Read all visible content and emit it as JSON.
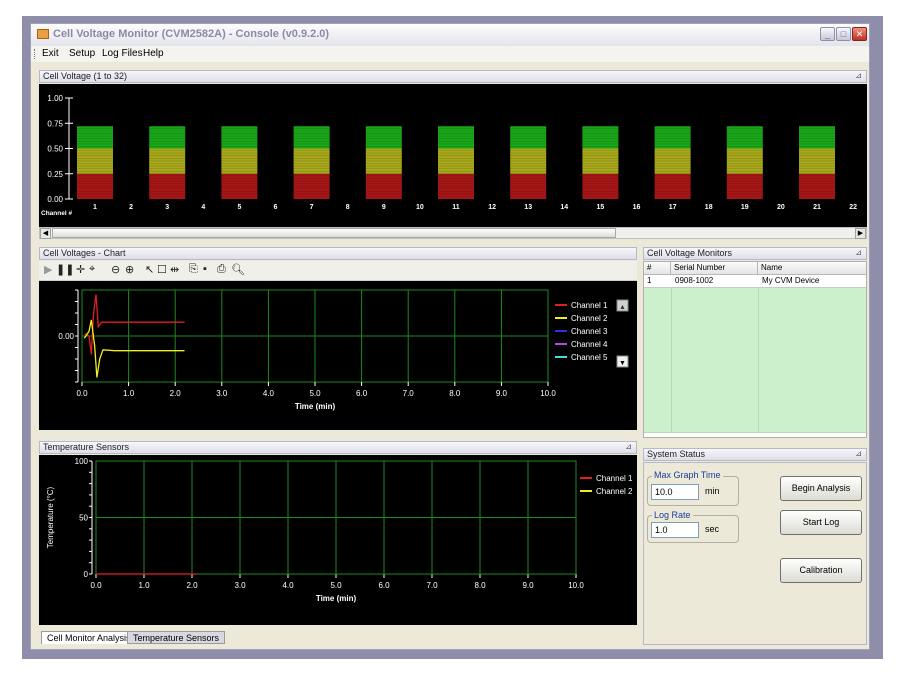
{
  "window": {
    "title": "Cell Voltage Monitor (CVM2582A) - Console (v0.9.2.0)",
    "minimize": "_",
    "maximize": "□",
    "close": "✕"
  },
  "menu": [
    "Exit",
    "Setup",
    "Log Files",
    "Help"
  ],
  "voltage_panel": {
    "title": "Cell Voltage (1 to 32)",
    "channel_label": "Channel #",
    "colors": {
      "high": "#19a619",
      "mid": "#a8a81c",
      "low": "#a61616"
    }
  },
  "chart_panel": {
    "title": "Cell Voltages - Chart",
    "toolbar_icons": [
      "play-icon",
      "pause-icon",
      "pan-icon",
      "zoom-box-icon",
      "zoom-out-icon",
      "zoom-in-icon",
      "pointer-icon",
      "select-box-icon",
      "fit-width-icon",
      "copy-icon",
      "save-icon",
      "print-icon",
      "print-preview-icon"
    ]
  },
  "temp_panel": {
    "title": "Temperature Sensors"
  },
  "monitors_panel": {
    "title": "Cell Voltage Monitors",
    "columns": [
      "#",
      "Serial Number",
      "Name"
    ],
    "rows": [
      [
        "1",
        "0908-1002",
        "My CVM Device"
      ]
    ]
  },
  "status_panel": {
    "title": "System Status",
    "max_graph_time": {
      "label": "Max Graph Time",
      "value": "10.0",
      "unit": "min"
    },
    "log_rate": {
      "label": "Log Rate",
      "value": "1.0",
      "unit": "sec"
    },
    "buttons": {
      "begin": "Begin Analysis",
      "start_log": "Start Log",
      "calibration": "Calibration"
    }
  },
  "tabs": [
    "Cell Monitor Analysis",
    "Temperature Sensors"
  ],
  "chart_data": [
    {
      "type": "bar",
      "title": "Cell Voltage (1 to 32)",
      "xlabel": "Channel #",
      "categories": [
        "1",
        "2",
        "3",
        "4",
        "5",
        "6",
        "7",
        "8",
        "9",
        "10",
        "11",
        "12",
        "13",
        "14",
        "15",
        "16",
        "17",
        "18",
        "19",
        "20",
        "21",
        "22"
      ],
      "values": [
        0.72,
        0,
        0.72,
        0,
        0.72,
        0,
        0.72,
        0,
        0.72,
        0,
        0.72,
        0,
        0.72,
        0,
        0.72,
        0,
        0.72,
        0,
        0.72,
        0,
        0.72,
        0
      ],
      "ylim": [
        0,
        1.0
      ],
      "yticks": [
        "0.00",
        "0.25",
        "0.50",
        "0.75",
        "1.00"
      ],
      "color_bands": [
        {
          "from": 0,
          "to": 0.25,
          "color": "#a61616"
        },
        {
          "from": 0.25,
          "to": 0.5,
          "color": "#a8a81c"
        },
        {
          "from": 0.5,
          "to": 0.75,
          "color": "#19a619"
        }
      ]
    },
    {
      "type": "line",
      "xlabel": "Time (min)",
      "xticks": [
        "0.0",
        "1.0",
        "2.0",
        "3.0",
        "4.0",
        "5.0",
        "6.0",
        "7.0",
        "8.0",
        "9.0",
        "10.0"
      ],
      "yticks": [
        "0.00"
      ],
      "xlim": [
        0,
        10
      ],
      "ylim": [
        -1,
        1
      ],
      "grid": true,
      "legend": "right",
      "series": [
        {
          "name": "Channel 1",
          "color": "#e02020",
          "points": [
            [
              0.05,
              0.05
            ],
            [
              0.15,
              0.0
            ],
            [
              0.2,
              -0.4
            ],
            [
              0.25,
              0.5
            ],
            [
              0.3,
              0.9
            ],
            [
              0.35,
              0.2
            ],
            [
              0.42,
              0.3
            ],
            [
              0.6,
              0.3
            ],
            [
              2.2,
              0.3
            ]
          ]
        },
        {
          "name": "Channel 2",
          "color": "#f0f020",
          "points": [
            [
              0.05,
              -0.05
            ],
            [
              0.15,
              0.1
            ],
            [
              0.2,
              0.35
            ],
            [
              0.27,
              -0.2
            ],
            [
              0.32,
              -0.9
            ],
            [
              0.38,
              -0.5
            ],
            [
              0.45,
              -0.3
            ],
            [
              0.7,
              -0.32
            ],
            [
              2.2,
              -0.32
            ]
          ]
        },
        {
          "name": "Channel 3",
          "color": "#3030e0",
          "points": []
        },
        {
          "name": "Channel 4",
          "color": "#c040e0",
          "points": []
        },
        {
          "name": "Channel 5",
          "color": "#40e0e0",
          "points": []
        }
      ]
    },
    {
      "type": "line",
      "ylabel": "Temperature (°C)",
      "xlabel": "Time (min)",
      "xticks": [
        "0.0",
        "1.0",
        "2.0",
        "3.0",
        "4.0",
        "5.0",
        "6.0",
        "7.0",
        "8.0",
        "9.0",
        "10.0"
      ],
      "yticks": [
        "0",
        "50",
        "100"
      ],
      "xlim": [
        0,
        10
      ],
      "ylim": [
        0,
        100
      ],
      "grid": true,
      "legend": "right",
      "series": [
        {
          "name": "Channel 1",
          "color": "#e02020",
          "points": [
            [
              0,
              0
            ],
            [
              2.1,
              0
            ]
          ]
        },
        {
          "name": "Channel 2",
          "color": "#f0f020",
          "points": []
        }
      ]
    }
  ]
}
